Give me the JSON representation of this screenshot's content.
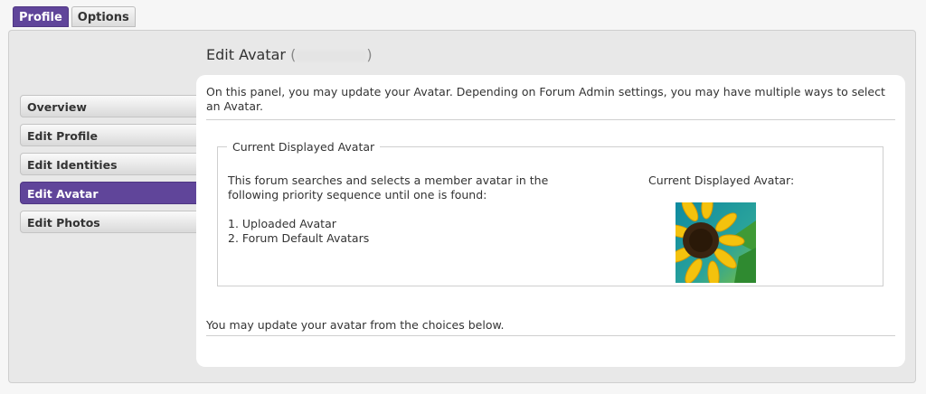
{
  "tabs": [
    {
      "label": "Profile",
      "active": true
    },
    {
      "label": "Options",
      "active": false
    }
  ],
  "sidebar": {
    "items": [
      {
        "label": "Overview"
      },
      {
        "label": "Edit Profile"
      },
      {
        "label": "Edit Identities"
      },
      {
        "label": "Edit Avatar"
      },
      {
        "label": "Edit Photos"
      }
    ]
  },
  "main": {
    "title": "Edit Avatar",
    "title_open": "(",
    "title_close": ")",
    "intro": "On this panel, you may update your Avatar. Depending on Forum Admin settings, you may have multiple ways to select an Avatar.",
    "section": {
      "legend": "Current Displayed Avatar",
      "description": "This forum searches and selects a member avatar in the following priority sequence until one is found:",
      "list": [
        "1. Uploaded Avatar",
        "2. Forum Default Avatars"
      ],
      "avatar_label": "Current Displayed Avatar:"
    },
    "bottom_text": "You may update your avatar from the choices below."
  },
  "colors": {
    "accent": "#60459a"
  }
}
